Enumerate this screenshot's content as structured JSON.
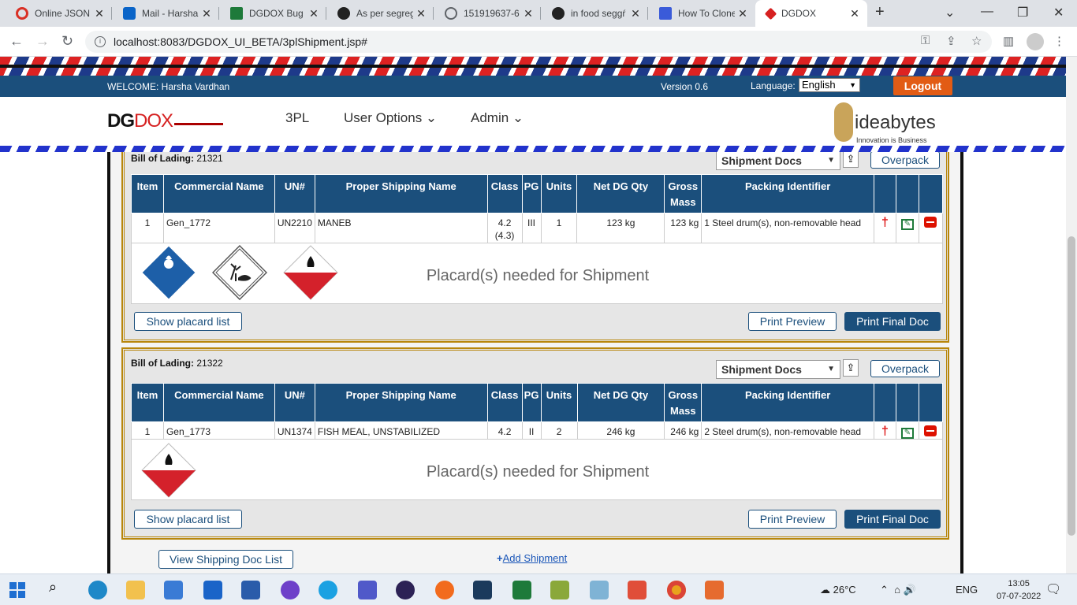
{
  "browser": {
    "tabs": [
      {
        "title": "Online JSON ’",
        "color": "#d93025"
      },
      {
        "title": "Mail - Harsha",
        "color": "#0a64c8"
      },
      {
        "title": "DGDOX Bug ’",
        "color": "#1e7a3a"
      },
      {
        "title": "As per segreg",
        "color": "#222222"
      },
      {
        "title": "151919637-6",
        "color": "#5f6368"
      },
      {
        "title": "in food seggŕ",
        "color": "#222222"
      },
      {
        "title": "How To Clone",
        "color": "#3a5bd9"
      },
      {
        "title": "DGDOX",
        "color": "#d62020"
      }
    ],
    "url": "localhost:8083/DGDOX_UI_BETA/3plShipment.jsp#"
  },
  "app": {
    "welcome": "WELCOME: Harsha Vardhan",
    "version": "Version 0.6",
    "language_label": "Language:",
    "language_value": "English",
    "logout": "Logout",
    "logo_dg": "DG",
    "logo_dox": "DOX",
    "menu": [
      "3PL",
      "User Options ⌄",
      "Admin ⌄"
    ],
    "partner_logo": "ideabytes",
    "partner_tag": "Innovation is Business"
  },
  "table_headers": [
    "Item",
    "Commercial Name",
    "UN#",
    "Proper Shipping Name",
    "Class",
    "PG",
    "Units",
    "Net DG Qty",
    "Gross Mass",
    "Packing Identifier"
  ],
  "shipments": [
    {
      "bol_label": "Bill of Lading:",
      "bol_number": "21321",
      "doc_select": "Shipment Docs",
      "overpack": "Overpack",
      "rows": [
        {
          "item": "1",
          "commercial": "Gen_1772",
          "un": "UN2210",
          "psn": "MANEB",
          "class": "4.2 (4.3)",
          "pg": "III",
          "units": "1",
          "net": "123 kg",
          "gross": "123 kg",
          "packing": "1 Steel drum(s), non-removable head"
        }
      ],
      "placards": [
        "class-5-oxidizer-placard",
        "environmental-hazard-placard",
        "class-4-2-spontaneous-combustion-placard"
      ],
      "placard_msg": "Placard(s) needed for Shipment",
      "show_placard": "Show placard list",
      "print_preview": "Print Preview",
      "print_final": "Print Final Doc"
    },
    {
      "bol_label": "Bill of Lading:",
      "bol_number": "21322",
      "doc_select": "Shipment Docs",
      "overpack": "Overpack",
      "rows": [
        {
          "item": "1",
          "commercial": "Gen_1773",
          "un": "UN1374",
          "psn": "FISH MEAL, UNSTABILIZED",
          "class": "4.2",
          "pg": "II",
          "units": "2",
          "net": "246 kg",
          "gross": "246 kg",
          "packing": "2 Steel drum(s), non-removable head"
        }
      ],
      "placards": [
        "class-4-2-spontaneous-combustion-placard"
      ],
      "placard_msg": "Placard(s) needed for Shipment",
      "show_placard": "Show placard list",
      "print_preview": "Print Preview",
      "print_final": "Print Final Doc"
    }
  ],
  "footer": {
    "view_doc_list": "View Shipping Doc List",
    "add_shipment": "Add Shipment"
  },
  "taskbar": {
    "weather": "26°C",
    "lang": "ENG",
    "time": "13:05",
    "date": "07-07-2022"
  },
  "colors": {
    "primary": "#1b4f7c",
    "logout": "#e25b14",
    "border_gold": "#b8860b"
  }
}
